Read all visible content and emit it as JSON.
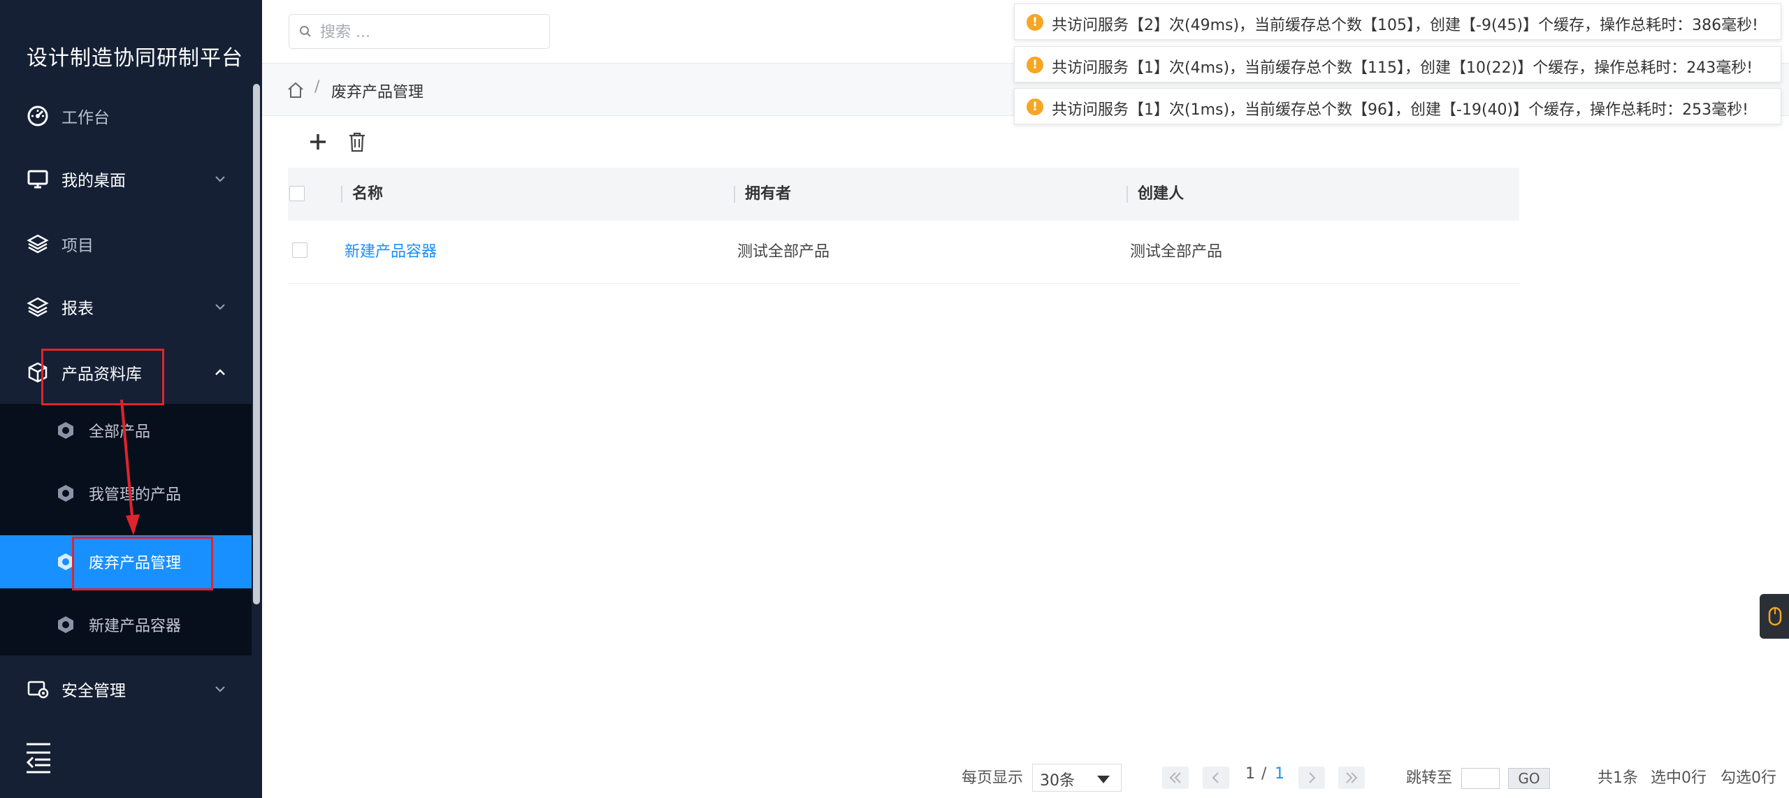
{
  "app": {
    "title": "设计制造协同研制平台"
  },
  "sidebar": {
    "items": [
      {
        "label": "工作台",
        "icon": "dashboard-icon"
      },
      {
        "label": "我的桌面",
        "icon": "monitor-icon",
        "expandable": true
      },
      {
        "label": "项目",
        "icon": "layers-icon"
      },
      {
        "label": "报表",
        "icon": "report-icon",
        "expandable": true
      },
      {
        "label": "产品资料库",
        "icon": "cube-icon",
        "expandable": true,
        "expanded": true
      },
      {
        "label": "安全管理",
        "icon": "security-icon",
        "expandable": true
      }
    ],
    "submenu": [
      {
        "label": "全部产品",
        "icon": "hex-icon"
      },
      {
        "label": "我管理的产品",
        "icon": "hex-icon"
      },
      {
        "label": "废弃产品管理",
        "icon": "hex-icon",
        "active": true
      },
      {
        "label": "新建产品容器",
        "icon": "hex-icon"
      }
    ],
    "collapse_icon": "collapse-menu-icon"
  },
  "header": {
    "search_placeholder": "搜索 ..."
  },
  "breadcrumb": {
    "current": "废弃产品管理",
    "separator": "/"
  },
  "toolbar": {
    "add_icon": "plus-icon",
    "delete_icon": "trash-icon"
  },
  "table": {
    "columns": [
      "名称",
      "拥有者",
      "创建人"
    ],
    "rows": [
      {
        "name": "新建产品容器",
        "owner": "测试全部产品",
        "creator": "测试全部产品"
      }
    ]
  },
  "pagination": {
    "per_page_label": "每页显示",
    "per_page_value": "30条",
    "current_page": "1",
    "page_sep": "/",
    "total_pages": "1",
    "jump_label": "跳转至",
    "go_label": "GO",
    "total_label": "共1条",
    "selected_label": "选中0行",
    "checked_label": "勾选0行"
  },
  "notifications": [
    {
      "text": "共访问服务【2】次(49ms)，当前缓存总个数【105】，创建【-9(45)】个缓存，操作总耗时：386毫秒!"
    },
    {
      "text": "共访问服务【1】次(4ms)，当前缓存总个数【115】，创建【10(22)】个缓存，操作总耗时：243毫秒!"
    },
    {
      "text": "共访问服务【1】次(1ms)，当前缓存总个数【96】，创建【-19(40)】个缓存，操作总耗时：253毫秒!"
    }
  ],
  "colors": {
    "sidebar_bg": "#152035",
    "submenu_bg": "#070f1c",
    "accent": "#1890ff",
    "highlight": "#e0242d",
    "warning": "#f5a623"
  }
}
